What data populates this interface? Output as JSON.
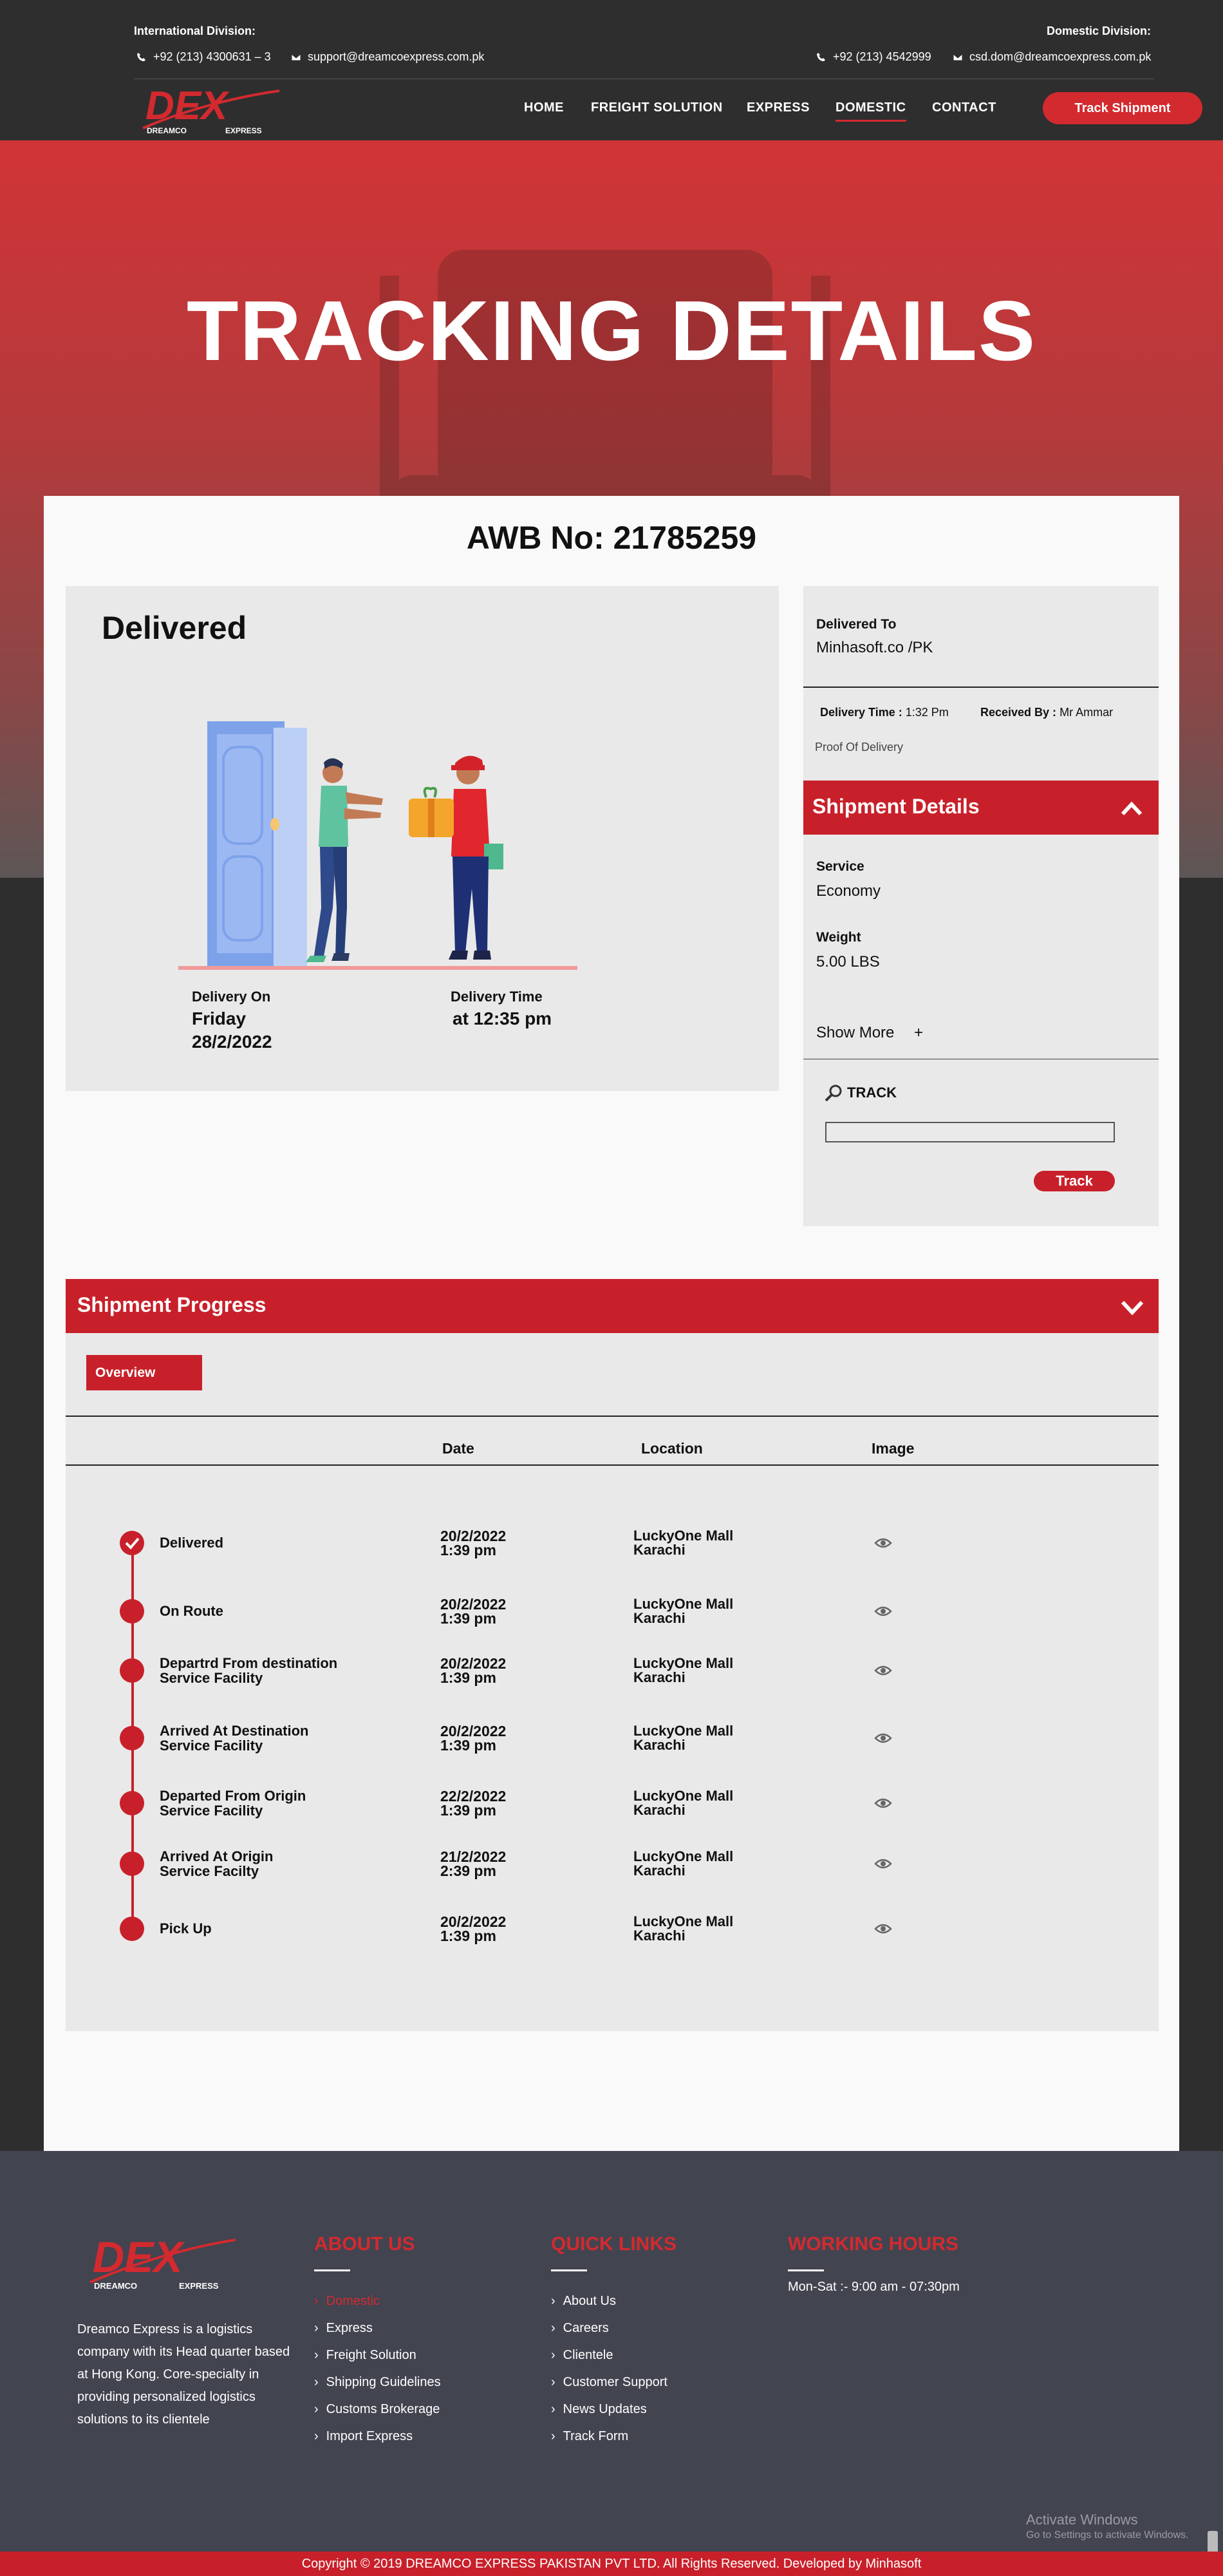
{
  "topbar": {
    "intl_title": "International Division:",
    "intl_phone": "+92 (213) 4300631 – 3",
    "intl_email": "support@dreamcoexpress.com.pk",
    "dom_title": "Domestic Division:",
    "dom_phone": "+92 (213) 4542999",
    "dom_email": "csd.dom@dreamcoexpress.com.pk"
  },
  "logo": {
    "mark": "DEX",
    "left": "DREAMCO",
    "right": "EXPRESS"
  },
  "nav": {
    "items": [
      "HOME",
      "FREIGHT SOLUTION",
      "EXPRESS",
      "DOMESTIC",
      "CONTACT"
    ],
    "active": "DOMESTIC",
    "cta": "Track Shipment"
  },
  "hero": {
    "title": "TRACKING DETAILS"
  },
  "awb": "AWB No: 21785259",
  "status": {
    "title": "Delivered",
    "delivery_on_label": "Delivery On",
    "delivery_on_day": "Friday",
    "delivery_on_date": "28/2/2022",
    "delivery_time_label": "Delivery Time",
    "delivery_time_value": "at 12:35 pm"
  },
  "side": {
    "delivered_to_label": "Delivered To",
    "delivered_to_value": "Minhasoft.co /PK",
    "delivery_time_label": "Delivery Time :",
    "delivery_time_value": "1:32 Pm",
    "received_by_label": "Received By :",
    "received_by_value": "Mr Ammar",
    "proof": "Proof Of Delivery",
    "shipment_details_title": "Shipment Details",
    "service_label": "Service",
    "service_value": "Economy",
    "weight_label": "Weight",
    "weight_value": "5.00 LBS",
    "show_more": "Show More",
    "show_more_icon": "+",
    "track_title": "TRACK",
    "track_button": "Track"
  },
  "progress": {
    "title": "Shipment Progress",
    "overview": "Overview",
    "columns": [
      "Date",
      "Location",
      "Image"
    ],
    "steps": [
      {
        "label1": "Delivered",
        "label2": "",
        "date": "20/2/2022",
        "time": "1:39 pm",
        "loc1": "LuckyOne Mall",
        "loc2": "Karachi",
        "done": true
      },
      {
        "label1": "On Route",
        "label2": "",
        "date": "20/2/2022",
        "time": "1:39 pm",
        "loc1": "LuckyOne Mall",
        "loc2": "Karachi",
        "done": false
      },
      {
        "label1": "Departrd From destination",
        "label2": "Service Facility",
        "date": "20/2/2022",
        "time": "1:39 pm",
        "loc1": "LuckyOne Mall",
        "loc2": "Karachi",
        "done": false
      },
      {
        "label1": "Arrived At Destination",
        "label2": "Service Facility",
        "date": "20/2/2022",
        "time": "1:39 pm",
        "loc1": "LuckyOne Mall",
        "loc2": "Karachi",
        "done": false
      },
      {
        "label1": "Departed From Origin",
        "label2": "Service Facility",
        "date": "22/2/2022",
        "time": "1:39 pm",
        "loc1": "LuckyOne Mall",
        "loc2": "Karachi",
        "done": false
      },
      {
        "label1": "Arrived At Origin",
        "label2": "Service Facilty",
        "date": "21/2/2022",
        "time": "2:39 pm",
        "loc1": "LuckyOne Mall",
        "loc2": "Karachi",
        "done": false
      },
      {
        "label1": "Pick Up",
        "label2": "",
        "date": "20/2/2022",
        "time": "1:39 pm",
        "loc1": "LuckyOne Mall",
        "loc2": "Karachi",
        "done": false
      }
    ]
  },
  "footer": {
    "about_text": "Dreamco Express is a logistics company with its Head quarter based at Hong Kong. Core-specialty in providing personalized logistics solutions to its clientele",
    "about_title": "ABOUT US",
    "about_links": [
      "Domestic",
      "Express",
      "Freight Solution",
      "Shipping Guidelines",
      "Customs Brokerage",
      "Import Express"
    ],
    "quick_title": "QUICK LINKS",
    "quick_links": [
      "About Us",
      "Careers",
      "Clientele",
      "Customer Support",
      "News Updates",
      "Track Form"
    ],
    "hours_title": "WORKING HOURS",
    "hours": "Mon-Sat :- 9:00 am - 07:30pm",
    "copyright": "Copyright © 2019 DREAMCO EXPRESS PAKISTAN PVT LTD. All Rights Reserved. Developed by Minhasoft"
  },
  "os_overlay": {
    "title": "Activate Windows",
    "subtitle": "Go to Settings to activate Windows."
  },
  "colors": {
    "brand_red": "#c8202a",
    "dark_bg": "#2e2e2f",
    "footer_bg": "#424450"
  }
}
